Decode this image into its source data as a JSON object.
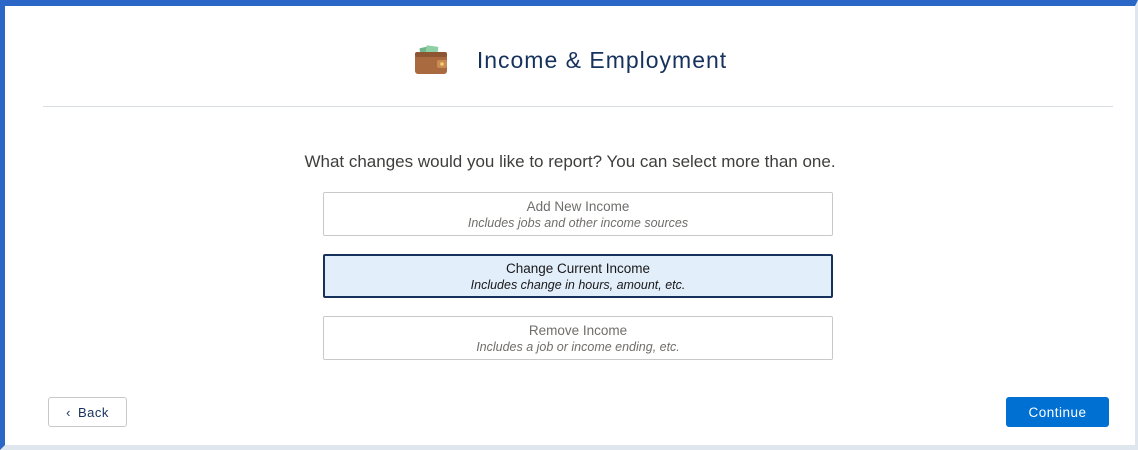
{
  "header": {
    "title": "Income & Employment",
    "icon": "wallet-icon"
  },
  "prompt": "What changes would you like to report? You can select more than one.",
  "options": [
    {
      "title": "Add New Income",
      "subtitle": "Includes jobs and other income sources",
      "selected": false
    },
    {
      "title": "Change Current Income",
      "subtitle": "Includes change in hours, amount, etc.",
      "selected": true
    },
    {
      "title": "Remove Income",
      "subtitle": "Includes a job or income ending, etc.",
      "selected": false
    }
  ],
  "footer": {
    "back_label": "Back",
    "back_icon": "chevron-left-icon",
    "continue_label": "Continue"
  },
  "colors": {
    "frame_accent": "#2a67c7",
    "primary_button": "#0070d2",
    "selected_background": "#e3eefb",
    "selected_border": "#16325c",
    "title_text": "#16325c"
  }
}
